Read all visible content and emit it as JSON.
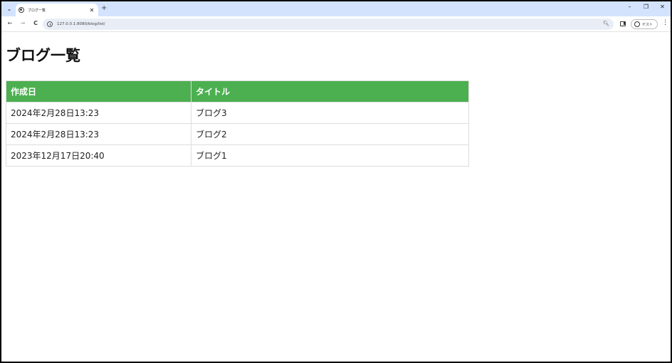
{
  "browser": {
    "tab_title": "ブログ一覧",
    "tab_close": "✕",
    "new_tab": "+",
    "url": "127.0.0.1:8080/blog/list/",
    "guest_label": "ゲスト",
    "window_controls": {
      "minimize": "–",
      "restore": "❐",
      "close": "✕"
    },
    "nav": {
      "back": "←",
      "forward": "→",
      "reload": "C"
    }
  },
  "page": {
    "heading": "ブログ一覧",
    "table": {
      "headers": [
        "作成日",
        "タイトル"
      ],
      "rows": [
        [
          "2024年2月28日13:23",
          "ブログ3"
        ],
        [
          "2024年2月28日13:23",
          "ブログ2"
        ],
        [
          "2023年12月17日20:40",
          "ブログ1"
        ]
      ]
    }
  },
  "colors": {
    "header_bg": "#4caf50",
    "tabstrip_bg": "#d3e3fd"
  }
}
